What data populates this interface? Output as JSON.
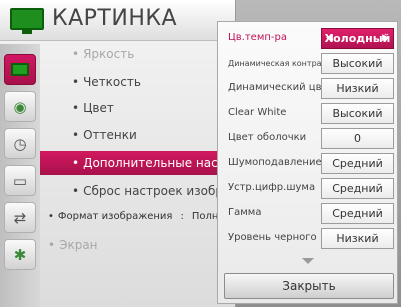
{
  "menu": {
    "title": "КАРТИНКА",
    "items": [
      {
        "label": "Яркость",
        "state": "dim"
      },
      {
        "label": "Четкость",
        "state": "normal"
      },
      {
        "label": "Цвет",
        "state": "normal"
      },
      {
        "label": "Оттенки",
        "state": "normal"
      },
      {
        "label": "Дополнительные настройки",
        "state": "selected"
      },
      {
        "label": "Сброс настроек изображения",
        "state": "normal"
      }
    ],
    "format_label": "Формат изображения",
    "format_separator": ":",
    "format_value": "Полный",
    "screen_label": "Экран",
    "side_icons": [
      "picture-icon",
      "audio-icon",
      "clock-icon",
      "toolbox-icon",
      "input-icon",
      "network-icon"
    ]
  },
  "panel": {
    "rows": [
      {
        "label": "Цв.темп-ра",
        "value": "Холодный",
        "active": true
      },
      {
        "label": "Динамическая контрастность",
        "value": "Высокий"
      },
      {
        "label": "Динамический цвет",
        "value": "Низкий"
      },
      {
        "label": "Clear White",
        "value": "Высокий"
      },
      {
        "label": "Цвет оболочки",
        "value": "0"
      },
      {
        "label": "Шумоподавление",
        "value": "Средний"
      },
      {
        "label": "Устр.цифр.шума",
        "value": "Средний"
      },
      {
        "label": "Гамма",
        "value": "Средний"
      },
      {
        "label": "Уровень черного",
        "value": "Низкий"
      }
    ],
    "close_label": "Закрыть"
  },
  "colors": {
    "accent": "#c0135a",
    "tv_green": "#1e8f1e"
  }
}
